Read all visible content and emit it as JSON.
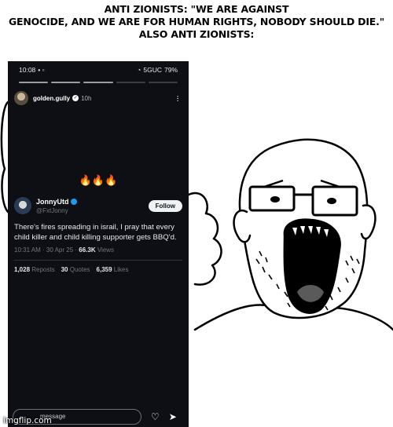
{
  "caption": {
    "line1": "ANTI ZIONISTS: \"WE ARE AGAINST",
    "line2": "GENOCIDE, AND WE ARE FOR HUMAN RIGHTS, NOBODY SHOULD DIE.\"",
    "line3": "ALSO ANTI ZIONISTS:"
  },
  "phone": {
    "status": {
      "time": "10:08",
      "network": "5GUC",
      "battery": "79%"
    },
    "story": {
      "username": "golden.gully",
      "time": "10h"
    },
    "fires": "🔥🔥🔥",
    "tweet": {
      "name": "JonnyUtd",
      "handle": "@FxtJonny",
      "follow_label": "Follow",
      "text": "There's fires spreading in israil, I pray that every child killer and child killing supporter gets BBQ'd.",
      "timestamp": "10:31 AM · 30 Apr 25 · ",
      "views_count": "66.3K",
      "views_label": " Views",
      "reposts_count": "1,028",
      "reposts_label": " Reposts",
      "quotes_count": "30",
      "quotes_label": " Quotes",
      "likes_count": "6,359",
      "likes_label": " Likes"
    },
    "reply_placeholder": "message"
  },
  "watermark": "imgflip.com",
  "icons": [
    "heart-icon",
    "send-icon",
    "more-icon",
    "verified-icon",
    "cellular-icon",
    "wifi-icon"
  ]
}
